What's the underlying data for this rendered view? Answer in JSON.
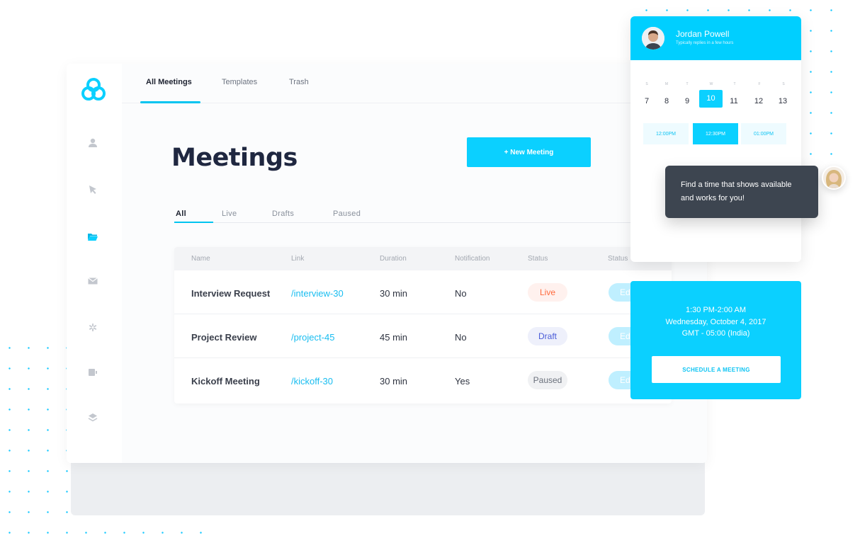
{
  "top_nav": {
    "tabs": [
      {
        "label": "All Meetings"
      },
      {
        "label": "Templates"
      },
      {
        "label": "Trash"
      }
    ]
  },
  "page": {
    "title": "Meetings",
    "new_button": "+ New Meeting"
  },
  "sub_tabs": [
    {
      "label": "All"
    },
    {
      "label": "Live"
    },
    {
      "label": "Drafts"
    },
    {
      "label": "Paused"
    }
  ],
  "table": {
    "headers": [
      "Name",
      "Link",
      "Duration",
      "Notification",
      "Status",
      "Status"
    ],
    "rows": [
      {
        "name": "Interview Request",
        "link": "/interview-30",
        "duration": "30 min",
        "notification": "No",
        "status": "Live",
        "action": "Edit"
      },
      {
        "name": "Project Review",
        "link": "/project-45",
        "duration": "45 min",
        "notification": "No",
        "status": "Draft",
        "action": "Edit"
      },
      {
        "name": "Kickoff Meeting",
        "link": "/kickoff-30",
        "duration": "30 min",
        "notification": "Yes",
        "status": "Paused",
        "action": "Edit"
      }
    ]
  },
  "booking": {
    "host_name": "Jordan Powell",
    "host_subtitle": "Typically replies in a few hours",
    "day_labels": [
      "S",
      "M",
      "T",
      "W",
      "T",
      "F",
      "S"
    ],
    "dates": [
      "7",
      "8",
      "9",
      "10",
      "11",
      "12",
      "13"
    ],
    "selected_date": "10",
    "times": [
      "12:00PM",
      "12:30PM",
      "01:00PM"
    ],
    "selected_time": "12:30PM"
  },
  "chat": {
    "message": "Find a time that shows available and works for you!"
  },
  "schedule": {
    "time_range": "1:30 PM-2:00 AM",
    "date": "Wednesday, October 4, 2017",
    "timezone": "GMT - 05:00 (India)",
    "button": "SCHEDULE A MEETING"
  },
  "colors": {
    "accent": "#0bd0ff",
    "live": "#ff6a3d",
    "draft": "#4a5cd8",
    "dark_card": "#3d4550"
  }
}
